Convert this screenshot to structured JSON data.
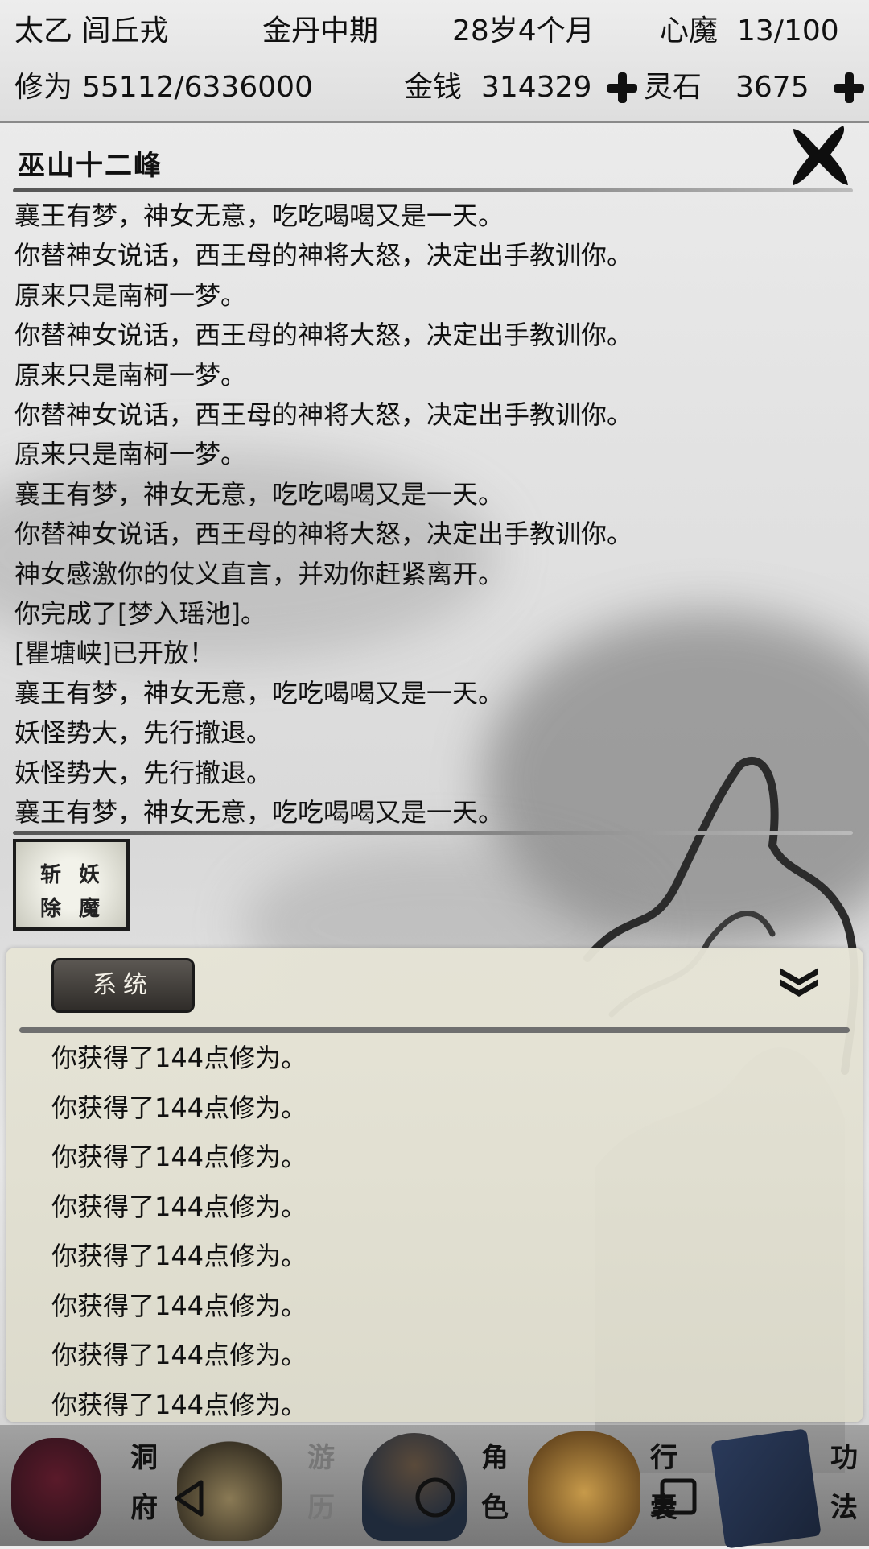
{
  "status": {
    "name": "太乙 闾丘戎",
    "realm": "金丹中期",
    "age": "28岁4个月",
    "heart_demon_label": "心魔",
    "heart_demon_value": "13/100",
    "cultivation_label": "修为",
    "cultivation_value": "55112/6336000",
    "money_label": "金钱",
    "money_value": "314329",
    "spirit_stone_label": "灵石",
    "spirit_stone_value": "3675"
  },
  "location": {
    "title": "巫山十二峰"
  },
  "event_log": [
    "襄王有梦，神女无意，吃吃喝喝又是一天。",
    "你替神女说话，西王母的神将大怒，决定出手教训你。",
    "原来只是南柯一梦。",
    "你替神女说话，西王母的神将大怒，决定出手教训你。",
    "原来只是南柯一梦。",
    "你替神女说话，西王母的神将大怒，决定出手教训你。",
    "原来只是南柯一梦。",
    "襄王有梦，神女无意，吃吃喝喝又是一天。",
    "你替神女说话，西王母的神将大怒，决定出手教训你。",
    "神女感激你的仗义直言，并劝你赶紧离开。",
    "你完成了[梦入瑶池]。",
    "[瞿塘峡]已开放！",
    "襄王有梦，神女无意，吃吃喝喝又是一天。",
    "妖怪势大，先行撤退。",
    "妖怪势大，先行撤退。",
    "襄王有梦，神女无意，吃吃喝喝又是一天。"
  ],
  "action_button": {
    "chars": [
      "斩",
      "妖",
      "除",
      "魔"
    ]
  },
  "system_panel": {
    "tab_label": "系统",
    "messages": [
      "你获得了144点修为。",
      "你获得了144点修为。",
      "你获得了144点修为。",
      "你获得了144点修为。",
      "你获得了144点修为。",
      "你获得了144点修为。",
      "你获得了144点修为。",
      "你获得了144点修为。"
    ]
  },
  "bottom_menu": {
    "items": [
      {
        "label_top": "洞",
        "label_bottom": "府",
        "icon": "cave-residence-icon"
      },
      {
        "label_top": "游",
        "label_bottom": "历",
        "icon": "travel-icon"
      },
      {
        "label_top": "角",
        "label_bottom": "色",
        "icon": "character-icon"
      },
      {
        "label_top": "行",
        "label_bottom": "囊",
        "icon": "bag-icon"
      },
      {
        "label_top": "功",
        "label_bottom": "法",
        "icon": "technique-icon"
      }
    ]
  },
  "nav_bar": {
    "back": "back-icon",
    "home": "home-icon",
    "recents": "recents-icon"
  },
  "colors": {
    "panel_bg": "#e4e2d4",
    "tab_bg": "#3d3a36",
    "ink": "#111111"
  }
}
